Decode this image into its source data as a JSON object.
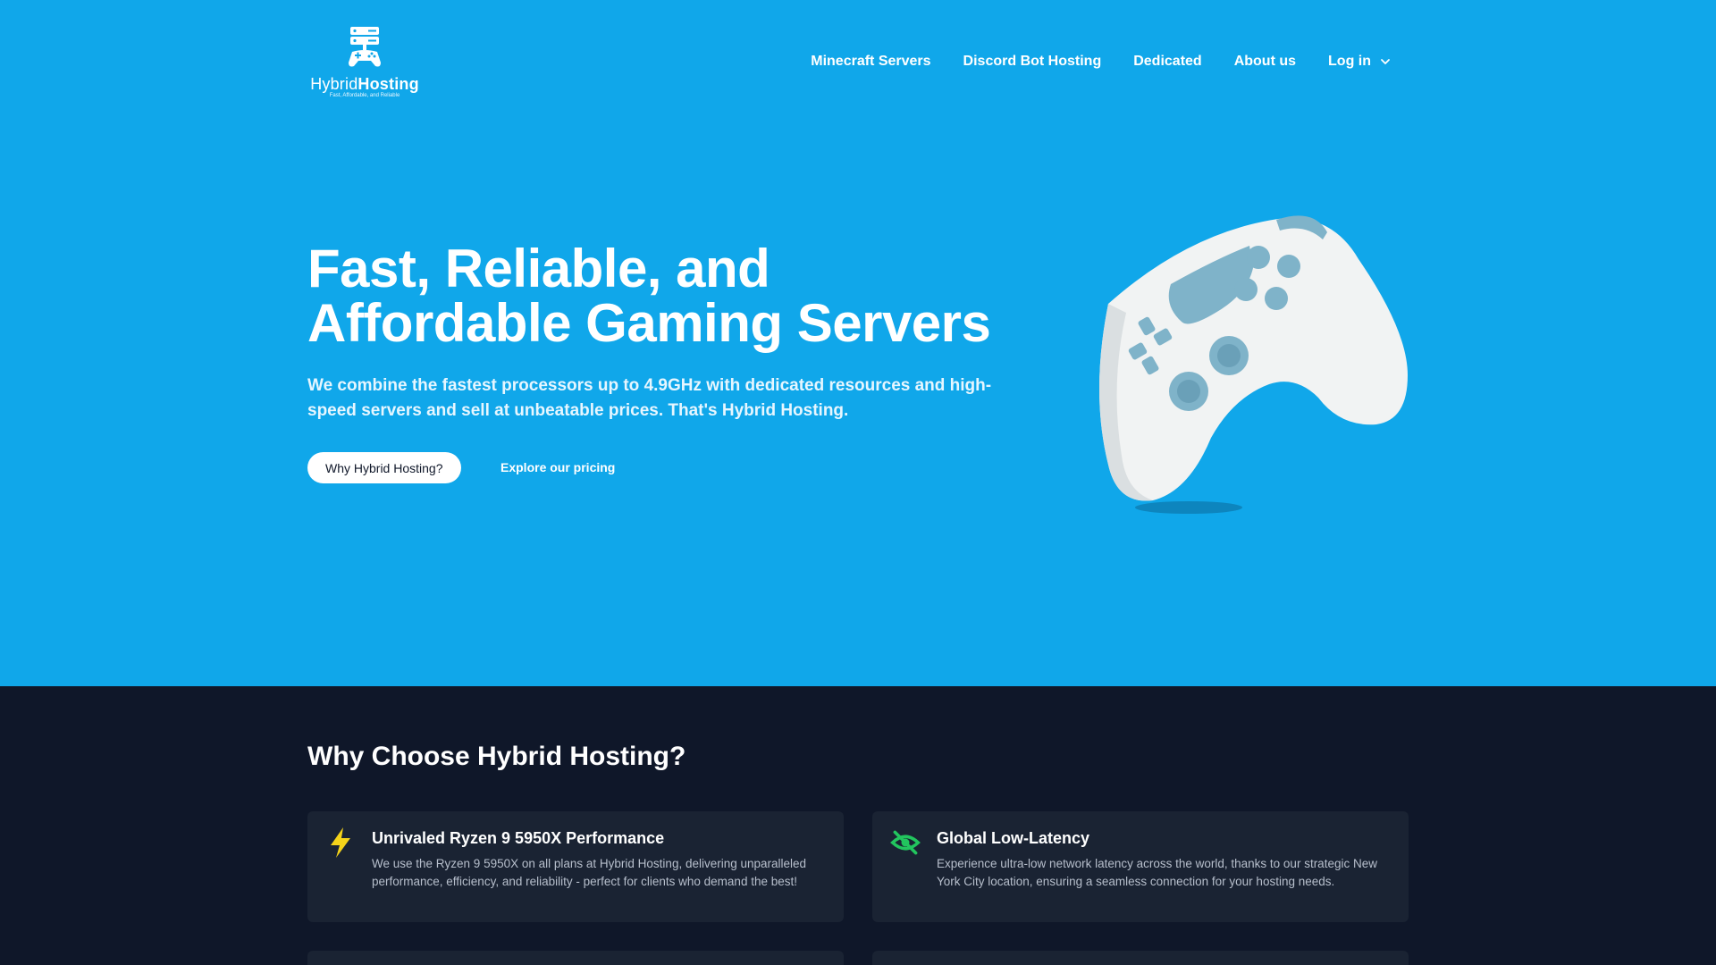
{
  "brand": {
    "name_part1": "Hybrid",
    "name_part2": "Hosting",
    "tagline": "Fast, Affordable, and Reliable",
    "accent_color": "#10a7ea",
    "dark_color": "#0f1729"
  },
  "nav": {
    "items": [
      {
        "label": "Minecraft Servers"
      },
      {
        "label": "Discord Bot Hosting"
      },
      {
        "label": "Dedicated"
      },
      {
        "label": "About us"
      },
      {
        "label": "Log in",
        "icon": "chevron-down-icon"
      }
    ]
  },
  "hero": {
    "title_line1": "Fast, Reliable, and",
    "title_line2": "Affordable Gaming Servers",
    "subtitle": "We combine the fastest processors up to 4.9GHz with dedicated resources and high-speed servers and sell at unbeatable prices. That's Hybrid Hosting.",
    "primary_button": "Why Hybrid Hosting?",
    "secondary_link": "Explore our pricing",
    "image": "game-controller-illustration"
  },
  "features": {
    "title": "Why Choose Hybrid Hosting?",
    "cards": [
      {
        "icon": "lightning-bolt-icon",
        "icon_color": "#f5d31a",
        "title": "Unrivaled Ryzen 9 5950X Performance",
        "text": "We use the Ryzen 9 5950X on all plans at Hybrid Hosting, delivering unparalleled performance, efficiency, and reliability - perfect for clients who demand the best!"
      },
      {
        "icon": "eye-off-icon",
        "icon_color": "#22c55e",
        "title": "Global Low-Latency",
        "text": "Experience ultra-low network latency across the world, thanks to our strategic New York City location, ensuring a seamless connection for your hosting needs."
      }
    ]
  }
}
